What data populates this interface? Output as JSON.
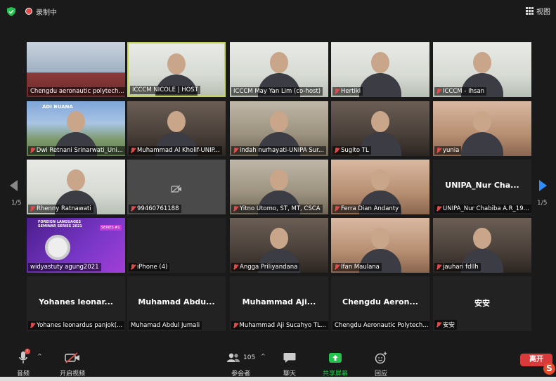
{
  "topbar": {
    "recording_label": "录制中",
    "view_label": "视图"
  },
  "pagination": {
    "left": "1/5",
    "right": "1/5"
  },
  "tiles": [
    {
      "name": "Chengdu aeronautic polytech...",
      "muted": false,
      "scene": "stage"
    },
    {
      "name": "ICCCM NICOLE | HOST",
      "muted": false,
      "scene": "cam-light",
      "active": true
    },
    {
      "name": "ICCCM May Yan Lim (co-host)",
      "muted": false,
      "scene": "cam-light"
    },
    {
      "name": "Hertiki",
      "muted": true,
      "scene": "cam-light"
    },
    {
      "name": "ICCCM - Ihsan",
      "muted": true,
      "scene": "cam-light"
    },
    {
      "name": "Dwi Retnani Srinarwati_Uni...",
      "muted": true,
      "scene": "campus"
    },
    {
      "name": "Muhammad Al Kholif-UNIP...",
      "muted": true,
      "scene": "cam-dark"
    },
    {
      "name": "indah nurhayati-UNIPA Sur...",
      "muted": true,
      "scene": "cam-room"
    },
    {
      "name": "Sugito TL",
      "muted": true,
      "scene": "cam-dark"
    },
    {
      "name": "yunia",
      "muted": true,
      "scene": "cam-warm"
    },
    {
      "name": "Rhenny Ratnawati",
      "muted": true,
      "scene": "cam-light"
    },
    {
      "name": "99460761188",
      "muted": true,
      "scene": "no-video"
    },
    {
      "name": "Yitno Utomo, ST, MT, CSCA",
      "muted": true,
      "scene": "cam-room"
    },
    {
      "name": "Ferra Dian Andanty",
      "muted": true,
      "scene": "cam-warm"
    },
    {
      "name": "UNIPA_Nur Chabiba A.R_19...",
      "muted": true,
      "scene": "text",
      "big": "UNIPA_Nur  Cha..."
    },
    {
      "name": "widyastuty agung2021",
      "muted": false,
      "scene": "slide"
    },
    {
      "name": "iPhone (4)",
      "muted": true,
      "scene": "blank"
    },
    {
      "name": "Angga Priliyandana",
      "muted": true,
      "scene": "cam-dark"
    },
    {
      "name": "Ifan Maulana",
      "muted": true,
      "scene": "cam-warm"
    },
    {
      "name": "jauhari fdllh",
      "muted": true,
      "scene": "cam-dark"
    },
    {
      "name": "Yohanes leonardus panjok(...",
      "muted": true,
      "scene": "text",
      "big": "Yohanes  leonar..."
    },
    {
      "name": "Muhamad Abdul Jumali",
      "muted": false,
      "scene": "text",
      "big": "Muhamad  Abdu..."
    },
    {
      "name": "Muhammad Aji Sucahyo TL...",
      "muted": true,
      "scene": "text",
      "big": "Muhammad  Aji..."
    },
    {
      "name": "Chengdu Aeronautic Polytech...",
      "muted": false,
      "scene": "text",
      "big": "Chengdu  Aeron..."
    },
    {
      "name": "安安",
      "muted": true,
      "scene": "text",
      "big": "安安"
    }
  ],
  "toolbar": {
    "audio": "音频",
    "video": "开启视频",
    "participants": "参会者",
    "participants_count": "105",
    "chat": "聊天",
    "share": "共享屏幕",
    "reactions": "回应",
    "leave": "离开",
    "audio_badge": "!"
  },
  "slide": {
    "title": "FOREIGN LANGUAGES SEMINAR SERIES 2021",
    "series": "SERIES #1"
  },
  "campus_banner": "ADI BUANA",
  "colors": {
    "accent_blue": "#2d8cff",
    "share_green": "#23c34e",
    "leave_red": "#d93b3b",
    "active_border": "#c8d85a"
  }
}
